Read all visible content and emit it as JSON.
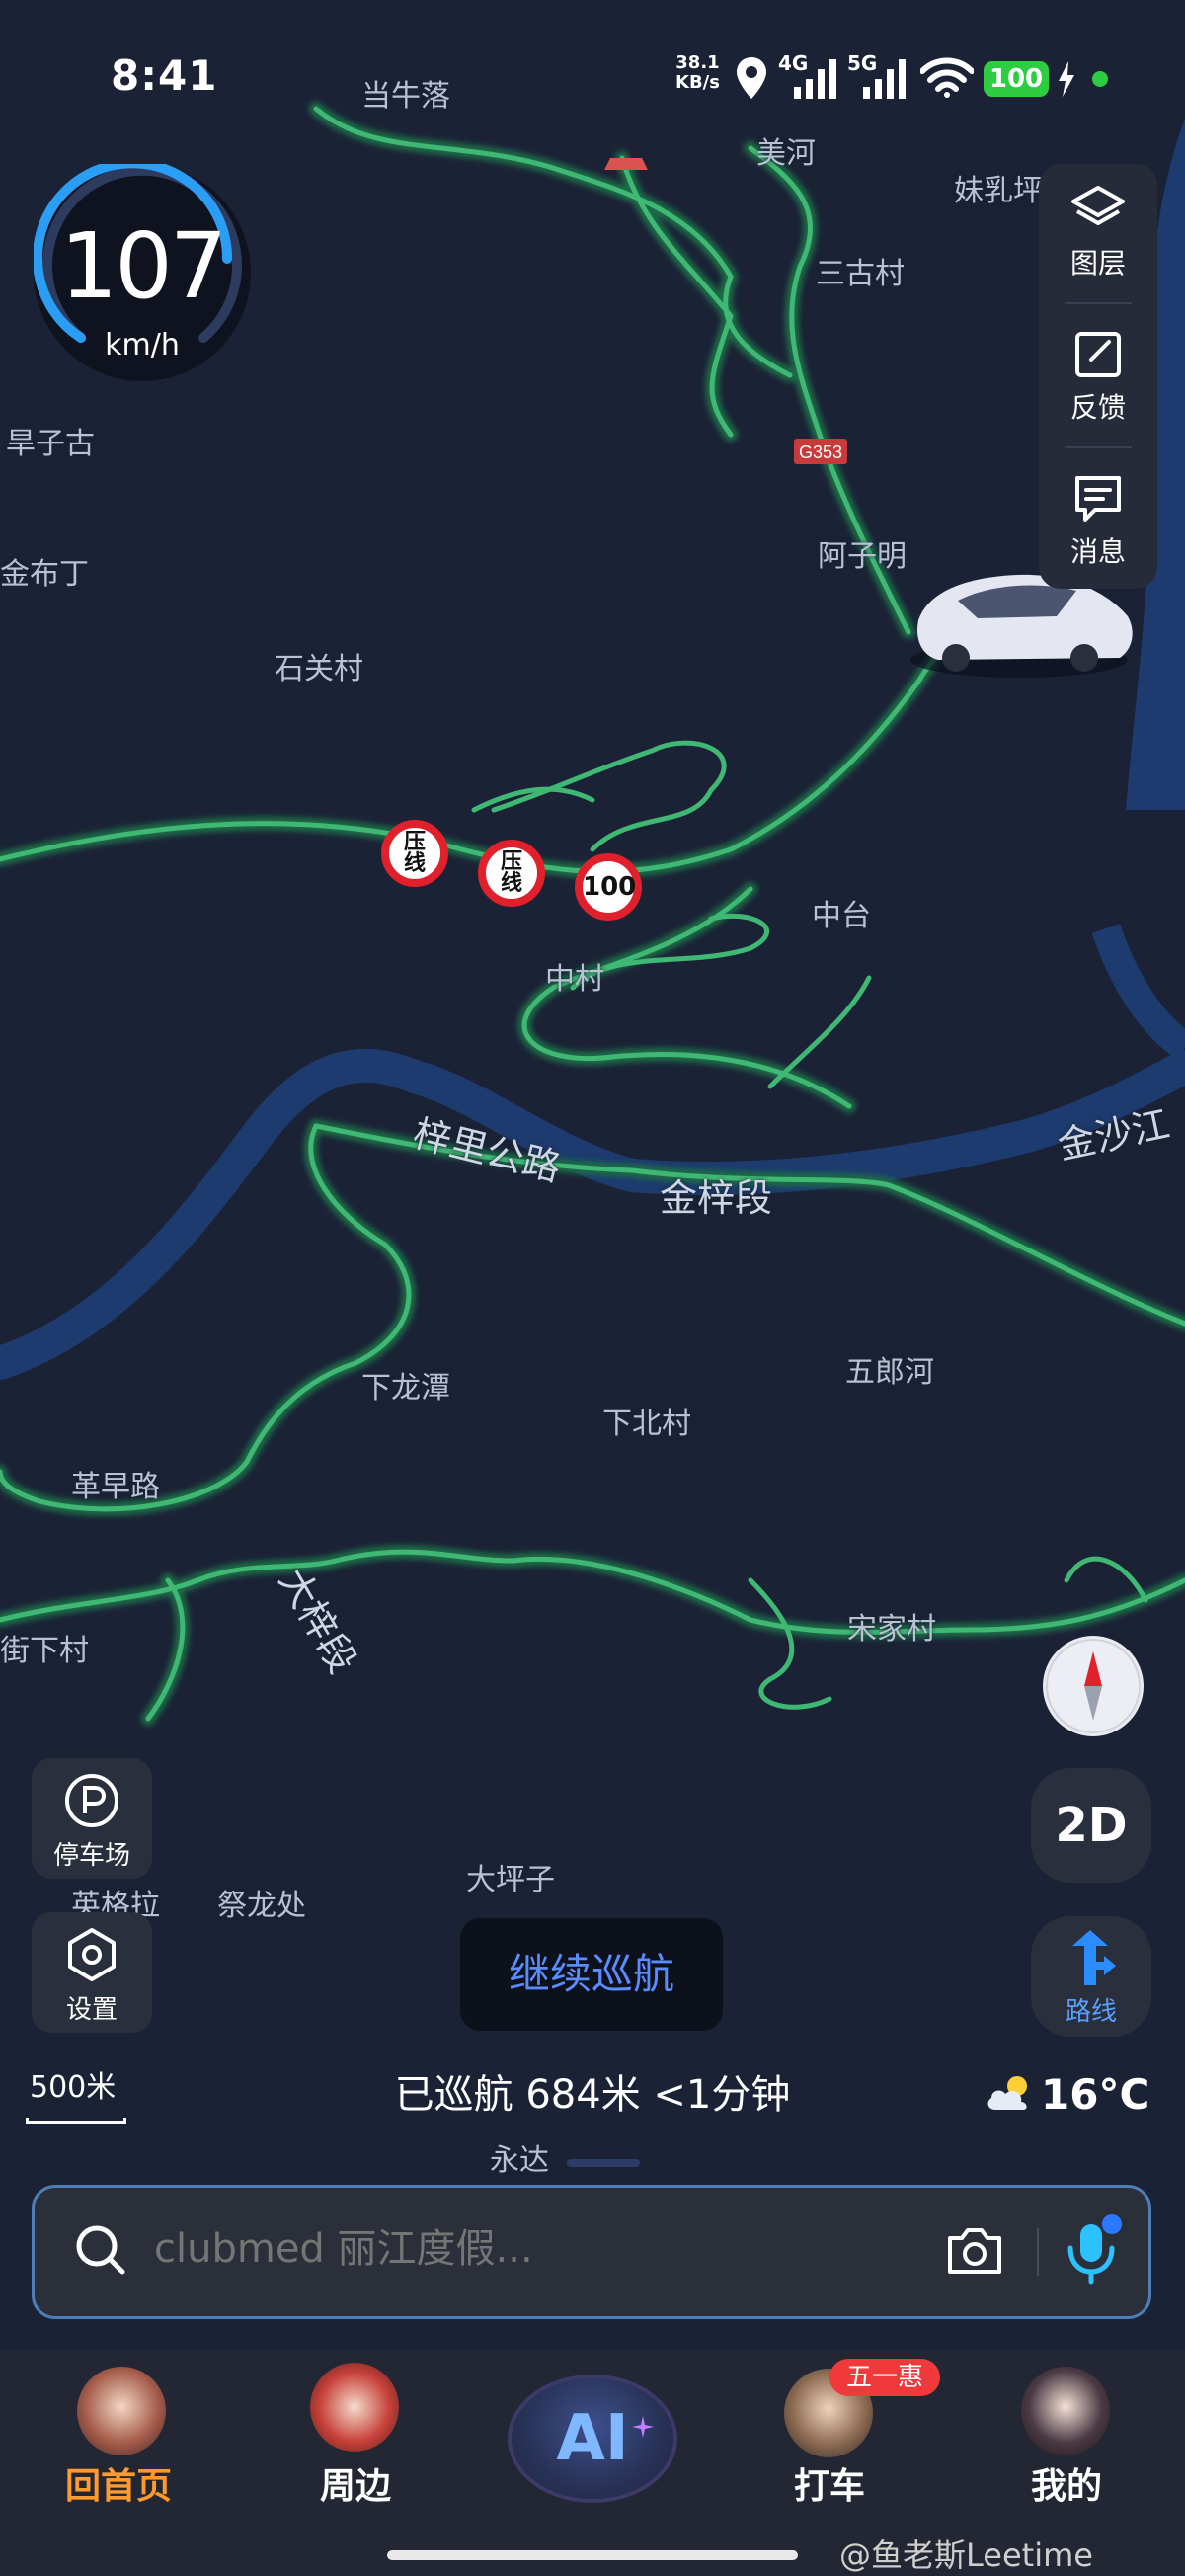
{
  "status_bar": {
    "time": "8:41",
    "net_speed_value": "38.1",
    "net_speed_unit": "KB/s",
    "signal_4g": "4G",
    "signal_5g": "5G",
    "battery": "100"
  },
  "speedometer": {
    "value": "107",
    "unit": "km/h"
  },
  "side_panel": {
    "items": [
      {
        "icon": "layers-icon",
        "label": "图层"
      },
      {
        "icon": "feedback-edit-icon",
        "label": "反馈"
      },
      {
        "icon": "message-icon",
        "label": "消息"
      }
    ]
  },
  "map": {
    "labels": [
      "当牛落",
      "美河",
      "妹乳坪",
      "三古村",
      "旱子古",
      "金布丁",
      "阿子明",
      "石关村",
      "中台",
      "中村",
      "金沙江",
      "梓里公路",
      "金梓段",
      "下龙潭",
      "五郎河",
      "下北村",
      "革早路",
      "大梓段",
      "宋家村",
      "街下村",
      "英格拉",
      "祭龙处",
      "大坪子",
      "永达"
    ],
    "route_shield": "G353",
    "signs": [
      {
        "type": "press-line",
        "line1": "压",
        "line2": "线"
      },
      {
        "type": "press-line",
        "line1": "压",
        "line2": "线"
      },
      {
        "type": "speed-limit",
        "value": "100"
      }
    ]
  },
  "controls": {
    "parking_label": "停车场",
    "settings_label": "设置",
    "view_mode": "2D",
    "route_label": "路线"
  },
  "cruise": {
    "continue_label": "继续巡航",
    "stats": "已巡航 684米 <1分钟"
  },
  "scale": {
    "label": "500米"
  },
  "weather": {
    "temperature": "16°C",
    "icon": "partly-cloudy-icon"
  },
  "search": {
    "placeholder": "clubmed 丽江度假..."
  },
  "bottom_nav": {
    "items": [
      {
        "label": "回首页",
        "active": true
      },
      {
        "label": "周边",
        "active": false
      },
      {
        "label": "AI",
        "active": false
      },
      {
        "label": "打车",
        "active": false,
        "badge": "五一惠"
      },
      {
        "label": "我的",
        "active": false
      }
    ]
  },
  "watermark": "@鱼老斯Leetime",
  "colors": {
    "map_background": "#1b2236",
    "road_green": "#3fb873",
    "river": "#1d3b6e",
    "accent_blue": "#5b8cff",
    "active_orange": "#ff9a2e",
    "battery_green": "#2ecc40",
    "sign_red": "#e0202a"
  }
}
